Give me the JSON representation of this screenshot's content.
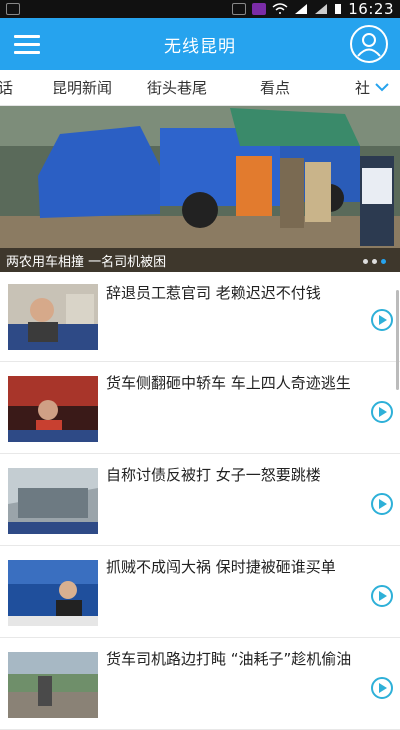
{
  "status_bar": {
    "time": "16:23",
    "battery_text": "■"
  },
  "app_bar": {
    "title": "无线昆明",
    "menu_icon": "hamburger-menu-icon",
    "profile_icon": "user-profile-icon"
  },
  "tabs": [
    {
      "label": "话"
    },
    {
      "label": "昆明新闻"
    },
    {
      "label": "街头巷尾"
    },
    {
      "label": "看点"
    },
    {
      "label": "社"
    }
  ],
  "hero": {
    "caption": "两农用车相撞 一名司机被困",
    "slide_count": 3,
    "active_slide": 2
  },
  "news": [
    {
      "title": "辞退员工惹官司 老赖迟迟不付钱",
      "thumb": "reporter-thumb"
    },
    {
      "title": "货车侧翻砸中轿车 车上四人奇迹逃生",
      "thumb": "night-scene-thumb"
    },
    {
      "title": "自称讨债反被打 女子一怒要跳楼",
      "thumb": "building-thumb"
    },
    {
      "title": "抓贼不成闯大祸 保时捷被砸谁买单",
      "thumb": "anchor-thumb"
    },
    {
      "title": "货车司机路边打盹 “油耗子”趁机偷油",
      "thumb": "street-thumb"
    }
  ],
  "colors": {
    "accent": "#26a3ee",
    "text": "#222222"
  }
}
